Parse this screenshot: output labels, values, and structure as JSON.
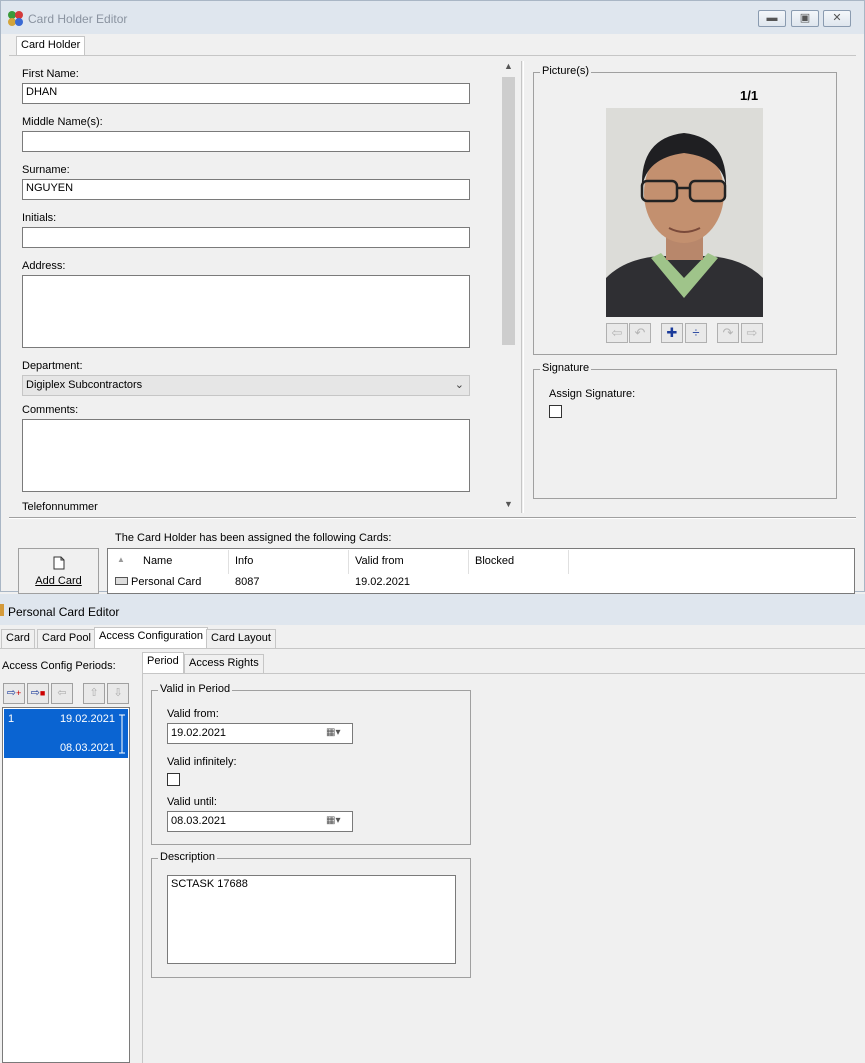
{
  "card_holder_editor": {
    "title": "Card Holder Editor",
    "tab": "Card Holder",
    "labels": {
      "first_name": "First Name:",
      "middle_names": "Middle Name(s):",
      "surname": "Surname:",
      "initials": "Initials:",
      "address": "Address:",
      "department": "Department:",
      "comments": "Comments:",
      "telefonnummer": "Telefonnummer"
    },
    "values": {
      "first_name": "DHAN",
      "middle_names": "",
      "surname": "NGUYEN",
      "initials": "",
      "address": "",
      "department": "Digiplex Subcontractors",
      "comments": ""
    },
    "pictures": {
      "legend": "Picture(s)",
      "counter": "1/1"
    },
    "signature": {
      "legend": "Signature",
      "assign_label": "Assign Signature:"
    },
    "cards": {
      "caption": "The Card Holder has been assigned the following Cards:",
      "add_card": "Add Card",
      "columns": [
        "Name",
        "Info",
        "Valid from",
        "Blocked"
      ],
      "rows": [
        {
          "name": "Personal Card",
          "info": "8087",
          "valid_from": "19.02.2021",
          "blocked": ""
        }
      ]
    }
  },
  "personal_card_editor": {
    "title": "Personal Card Editor",
    "tabs": [
      "Card",
      "Card Pool",
      "Access Configuration",
      "Card Layout"
    ],
    "active_tab": "Access Configuration",
    "periods_label": "Access Config Periods:",
    "periods": [
      {
        "index": "1",
        "from": "19.02.2021",
        "until": "08.03.2021"
      }
    ],
    "subtabs": [
      "Period",
      "Access Rights"
    ],
    "valid_in_period": {
      "legend": "Valid in Period",
      "valid_from_label": "Valid from:",
      "valid_from": "19.02.2021",
      "valid_infinitely_label": "Valid infinitely:",
      "valid_until_label": "Valid until:",
      "valid_until": "08.03.2021"
    },
    "description": {
      "legend": "Description",
      "text": "SCTASK 17688"
    }
  },
  "colors": {
    "selection": "#0a64d2",
    "titlebar": "#dfe6ee"
  }
}
